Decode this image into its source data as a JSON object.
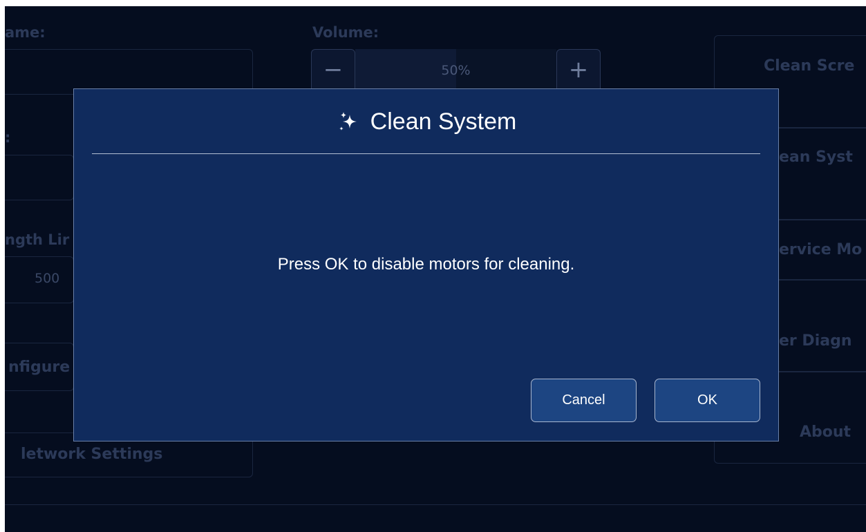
{
  "background": {
    "name_label": "ame:",
    "volume_label": "Volume:",
    "volume_value": "50%",
    "volume_level": 0.5,
    "left_label_2": ":",
    "length_label": "ngth Lir",
    "length_value": "500",
    "configure_label": "nfigure",
    "network_label": "letwork Settings",
    "right_buttons": [
      "Clean Scre",
      "ean Syst",
      "ervice Mo",
      "er Diagn",
      "About"
    ],
    "minus": "−",
    "plus": "+"
  },
  "dialog": {
    "title": "Clean System",
    "icon": "sparkle-icon",
    "message": "Press OK to disable motors for cleaning.",
    "cancel_label": "Cancel",
    "ok_label": "OK"
  },
  "colors": {
    "screen_bg": "#050d1f",
    "dialog_bg": "#102b5d",
    "button_bg": "#1d4582",
    "text": "#ffffff"
  }
}
